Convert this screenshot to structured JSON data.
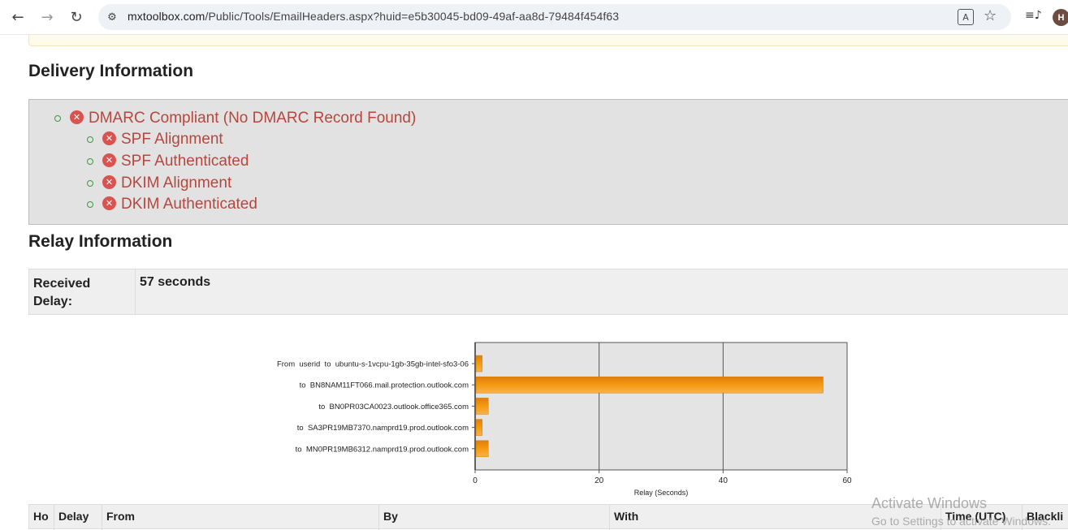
{
  "browser": {
    "url_host": "mxtoolbox.com",
    "url_path": "/Public/Tools/EmailHeaders.aspx?huid=e5b30045-bd09-49af-aa8d-79484f454f63",
    "profile_initial": "H"
  },
  "delivery": {
    "heading": "Delivery Information",
    "dmarc_label": "DMARC Compliant (No DMARC Record Found)",
    "checks": [
      "SPF Alignment",
      "SPF Authenticated",
      "DKIM Alignment",
      "DKIM Authenticated"
    ]
  },
  "relay": {
    "heading": "Relay Information",
    "received_delay_label": "Received Delay:",
    "received_delay_value": "57 seconds"
  },
  "chart_data": {
    "type": "bar",
    "orientation": "horizontal",
    "categories": [
      "From  userid  to  ubuntu-s-1vcpu-1gb-35gb-intel-sfo3-06",
      "to  BN8NAM11FT066.mail.protection.outlook.com",
      "to  BN0PR03CA0023.outlook.office365.com",
      "to  SA3PR19MB7370.namprd19.prod.outlook.com",
      "to  MN0PR19MB6312.namprd19.prod.outlook.com"
    ],
    "values": [
      1,
      56,
      2,
      1,
      2
    ],
    "xlabel": "Relay (Seconds)",
    "xlim": [
      0,
      60
    ],
    "xticks": [
      "0",
      "20",
      "40",
      "60"
    ],
    "grid": true,
    "bar_color": "#f59a12"
  },
  "hops_table": {
    "columns": [
      "Ho",
      "Delay",
      "From",
      "By",
      "With",
      "Time (UTC)",
      "Blackli"
    ]
  },
  "watermark": {
    "line1": "Activate Windows",
    "line2": "Go to Settings to activate Windows."
  }
}
